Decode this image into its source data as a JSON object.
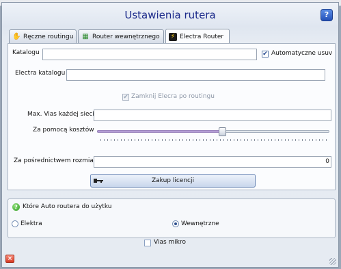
{
  "window": {
    "title": "Ustawienia rutera"
  },
  "tabs": [
    {
      "label": "Ręczne routingu",
      "icon": "hand-icon"
    },
    {
      "label": "Router wewnętrznego",
      "icon": "router-icon"
    },
    {
      "label": "Electra Router",
      "icon": "lightning-icon",
      "active": true
    }
  ],
  "form": {
    "katalogu_label": "Katalogu",
    "katalogu_value": "",
    "auto_label": "Automatyczne usuv",
    "auto_checked": true,
    "electra_label": "Electra katalogu",
    "electra_value": "",
    "close_electra_label": "Zamknij Elecra po routingu",
    "close_electra_checked": true,
    "max_vias_label": "Max. Vias każdej sieci",
    "max_vias_value": "",
    "cost_label": "Za pomocą kosztów",
    "cost_level": 0.54,
    "size_label": "Za pośrednictwem rozmiar",
    "size_value": "0",
    "license_button": "Zakup licencji"
  },
  "auto_router": {
    "heading": "Które Auto routera do użytku",
    "options": [
      {
        "label": "Elektra",
        "selected": false
      },
      {
        "label": "Wewnętrzne",
        "selected": true
      }
    ]
  },
  "vias_mikro": {
    "label": "Vias mikro",
    "checked": false
  },
  "colors": {
    "title": "#1b2a8a",
    "accent": "#2350b8"
  }
}
